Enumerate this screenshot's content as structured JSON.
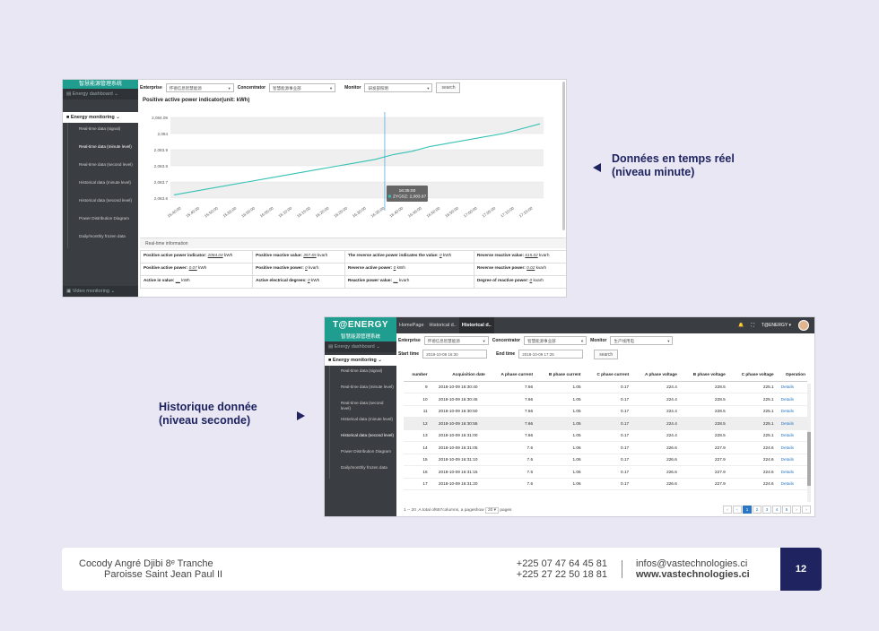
{
  "screen1": {
    "sidebar": {
      "logo": "智慧能源管理系统",
      "dashboard": "Energy dashboard",
      "monitoring": "Energy monitoring",
      "items": [
        "Real-time data (signal)",
        "Real-time data (minute level)",
        "Real-time data (second level)",
        "Historical data (minute level)",
        "Historical data (second level)",
        "Power Distribution Diagram",
        "Daily/monthly frozen data"
      ],
      "video": "Video monitoring"
    },
    "filters": {
      "enterprise_label": "Enterprise",
      "enterprise_value": "怀德信息智慧能源",
      "concentrator_label": "Concentrator",
      "concentrator_value": "智慧能源事业部",
      "monitor_label": "Monitor",
      "monitor_value": "研发部照明",
      "search": "search"
    },
    "chart_title": "Positive active power indicator(unit: kWh)",
    "tooltip": {
      "time": "16:35:00",
      "series": "ZYGSZ: 2,083.87"
    },
    "realtime_title": "Real-time information",
    "info": [
      [
        {
          "k": "Positive active power indicator:",
          "v": "2084.04",
          "u": "kWh"
        },
        {
          "k": "Positive reactive value:",
          "v": "357.65",
          "u": "kvarh"
        },
        {
          "k": "The reverse active power indicates the value:",
          "v": "0",
          "u": "kWh"
        },
        {
          "k": "Reverse reactive value:",
          "v": "615.02",
          "u": "kvarh"
        }
      ],
      [
        {
          "k": "Positive active power:",
          "v": "0.07",
          "u": "kWh"
        },
        {
          "k": "Positive reactive power:",
          "v": "0",
          "u": "kvarh"
        },
        {
          "k": "Reverse active power:",
          "v": "0",
          "u": "kWh"
        },
        {
          "k": "Reverse reactive power:",
          "v": "0.02",
          "u": "kvarh"
        }
      ],
      [
        {
          "k": "Active in value:",
          "v": "__",
          "u": "kWh"
        },
        {
          "k": "Active electrical degrees:",
          "v": "0",
          "u": "kWh"
        },
        {
          "k": "Reactive power value:",
          "v": "__",
          "u": "kvarh"
        },
        {
          "k": "Degree of reactive power:",
          "v": "0",
          "u": "kvarh"
        }
      ]
    ]
  },
  "chart_data": {
    "type": "line",
    "title": "Positive active power indicator(unit: kWh)",
    "y_ticks": [
      "2,084.09",
      "2,084",
      "2,083.9",
      "2,083.8",
      "2,083.7",
      "2,083.6"
    ],
    "ylim": [
      2083.6,
      2084.1
    ],
    "x_ticks": [
      "15:40:00",
      "15:45:00",
      "15:50:00",
      "15:55:00",
      "16:00:00",
      "16:05:00",
      "16:10:00",
      "16:15:00",
      "16:20:00",
      "16:25:00",
      "16:30:00",
      "16:35:00",
      "16:40:00",
      "16:45:00",
      "16:50:00",
      "16:55:00",
      "17:00:00",
      "17:05:00",
      "17:10:00",
      "17:15:00"
    ],
    "series": [
      {
        "values": [
          2083.62,
          2083.64,
          2083.66,
          2083.68,
          2083.7,
          2083.72,
          2083.74,
          2083.76,
          2083.78,
          2083.8,
          2083.82,
          2083.84,
          2083.87,
          2083.89,
          2083.92,
          2083.94,
          2083.96,
          2083.98,
          2084.0,
          2084.03,
          2084.06
        ]
      }
    ],
    "highlight_x": "16:35:00",
    "grid": true
  },
  "callouts": {
    "realtime": [
      "Données en temps réel",
      "(niveau minute)"
    ],
    "history": [
      "Historique donnée",
      "(niveau seconde)"
    ]
  },
  "screen2": {
    "brand": "T@ENERGY",
    "tabs": [
      "HomePage",
      "Historical d..",
      "Historical d.."
    ],
    "user": "T@ENERGY",
    "sidebar": {
      "logo": "智慧能源管理系统",
      "dashboard": "Energy dashboard",
      "monitoring": "Energy monitoring",
      "items": [
        "Real-time data (signal)",
        "Real-time data (minute level)",
        "Real-time data (second level)",
        "Historical data (minute level)",
        "Historical data (second level)",
        "Power Distribution Diagram",
        "Daily/monthly frozen data"
      ]
    },
    "filters": {
      "enterprise_label": "Enterprise",
      "enterprise_value": "怀德信息智慧能源",
      "concentrator_label": "Concentrator",
      "concentrator_value": "智慧能源事业部",
      "monitor_label": "Monitor",
      "monitor_value": "生产线用电",
      "start_label": "Start time",
      "start_value": "2018-10-09 16:30",
      "end_label": "End time",
      "end_value": "2018-10-09 17:25",
      "search": "search"
    },
    "columns": [
      "number",
      "Acquisition date",
      "A phase current",
      "B phase current",
      "C phase current",
      "A phase voltage",
      "B phase voltage",
      "C phase voltage",
      "Operation"
    ],
    "rows": [
      [
        "9",
        "2018-10-09 16:30:40",
        "7.66",
        "1.05",
        "0.17",
        "224.4",
        "228.5",
        "225.1",
        "Details"
      ],
      [
        "10",
        "2018-10-09 16:30:45",
        "7.66",
        "1.05",
        "0.17",
        "224.4",
        "228.5",
        "225.1",
        "Details"
      ],
      [
        "11",
        "2018-10-09 16:30:50",
        "7.66",
        "1.05",
        "0.17",
        "224.4",
        "228.5",
        "225.1",
        "Details"
      ],
      [
        "12",
        "2018-10-09 16:30:55",
        "7.66",
        "1.05",
        "0.17",
        "224.4",
        "228.5",
        "225.1",
        "Details"
      ],
      [
        "13",
        "2018-10-09 16:31:00",
        "7.66",
        "1.05",
        "0.17",
        "224.4",
        "228.5",
        "225.1",
        "Details"
      ],
      [
        "14",
        "2018-10-09 16:31:05",
        "7.6",
        "1.06",
        "0.17",
        "226.6",
        "227.9",
        "224.6",
        "Details"
      ],
      [
        "15",
        "2018-10-09 16:31:10",
        "7.6",
        "1.06",
        "0.17",
        "226.6",
        "227.9",
        "224.6",
        "Details"
      ],
      [
        "16",
        "2018-10-09 16:31:15",
        "7.6",
        "1.06",
        "0.17",
        "226.6",
        "227.9",
        "224.6",
        "Details"
      ],
      [
        "17",
        "2018-10-09 16:31:20",
        "7.6",
        "1.06",
        "0.17",
        "226.6",
        "227.9",
        "224.6",
        "Details"
      ]
    ],
    "highlight_row": 3,
    "footer_text": "1 -- 20 ,A total of657columns, a pageshow",
    "page_size": "20 ▾",
    "pages_word": "pages",
    "pager": [
      "‹",
      "‹",
      "1",
      "2",
      "3",
      "4",
      "5",
      "›",
      "›"
    ],
    "active_page": "1"
  },
  "footer": {
    "address1": "Cocody Angré Djibi 8ᵉ Tranche",
    "address2": "Paroisse Saint Jean Paul II",
    "phone1": "+225 07 47 64 45 81",
    "phone2": "+225 27 22 50 18 81",
    "email": "infos@vastechnologies.ci",
    "web": "www.vastechnologies.ci",
    "page": "12"
  },
  "colors": {
    "navy": "#1f2461",
    "teal": "#1f9d8e",
    "line": "#35c2b5",
    "sidebar": "#3a3d42",
    "link": "#2b77c4"
  }
}
